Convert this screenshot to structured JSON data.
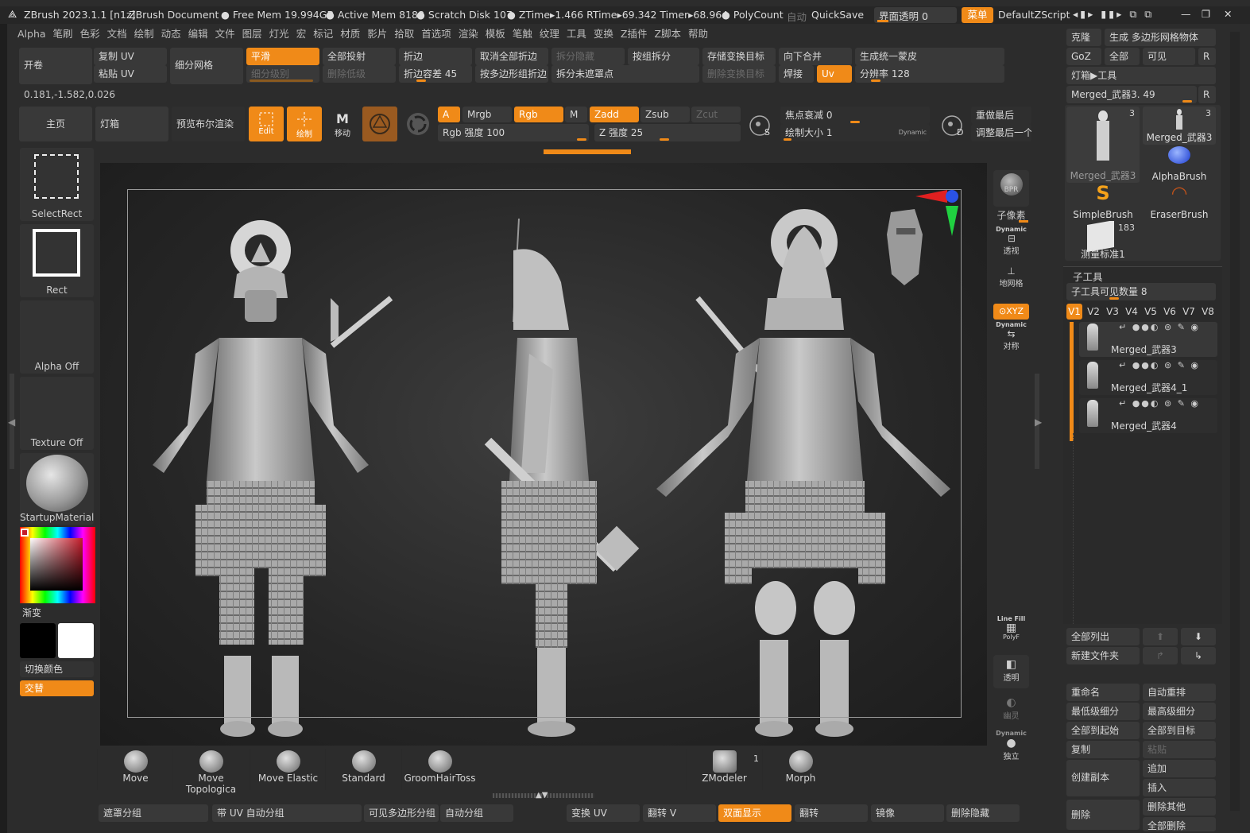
{
  "titlebar": {
    "app": "ZBrush 2023.1.1 [n1z]",
    "doc": "ZBrush Document",
    "free_mem": "Free Mem 19.994GB",
    "active_mem": "Active Mem 8188",
    "scratch": "Scratch Disk 107",
    "ztime": "ZTime▸1.466 RTime▸69.342 Timer▸68.964",
    "polycount": "PolyCount",
    "auto": "自动",
    "quicksave": "QuickSave",
    "transparency": "界面透明 0",
    "menu_btn": "菜单",
    "zscript": "DefaultZScript"
  },
  "menubar": [
    "Alpha",
    "笔刷",
    "色彩",
    "文档",
    "绘制",
    "动态",
    "编辑",
    "文件",
    "图层",
    "灯光",
    "宏",
    "标记",
    "材质",
    "影片",
    "拾取",
    "首选项",
    "渲染",
    "模板",
    "笔触",
    "纹理",
    "工具",
    "变换",
    "Z插件",
    "Z脚本",
    "帮助"
  ],
  "top_shelf": {
    "open": "开卷",
    "copy_uv": "复制 UV",
    "paste_uv": "粘贴 UV",
    "subdivide": "细分网格",
    "smooth": "平滑",
    "subdiv_level": "细分级别",
    "project_all": "全部投射",
    "delete_lower": "删除低级",
    "crease": "折边",
    "crease_tol": "折边容差 45",
    "uncrease_all": "取消全部折边",
    "crease_polygroups": "按多边形组折边",
    "split_hidden": "拆分隐藏",
    "split_unmasked": "拆分未遮罩点",
    "groups_split": "按组拆分",
    "store_morph": "存储变换目标",
    "delete_morph": "删除变换目标",
    "merge_down": "向下合并",
    "weld": "焊接",
    "uv": "Uv",
    "unified_skin": "生成统一蒙皮",
    "resolution": "分辨率 128"
  },
  "coords": "0.181,-1.582,0.026",
  "toolbar": {
    "home": "主页",
    "lightbox": "灯箱",
    "preview_boolean": "预览布尔渲染",
    "edit": "Edit",
    "draw": "绘制",
    "move": "移动",
    "a": "A",
    "mrgb": "Mrgb",
    "rgb": "Rgb",
    "m": "M",
    "zadd": "Zadd",
    "zsub": "Zsub",
    "zcut": "Zcut",
    "rgb_intensity": "Rgb 强度 100",
    "z_intensity": "Z 强度 25",
    "focal": "焦点衰减 0",
    "draw_size": "绘制大小 1",
    "dynamic": "Dynamic",
    "redo_last": "重做最后",
    "adjust_last": "调整最后一个"
  },
  "left_panel": {
    "selectrect": "SelectRect",
    "rect": "Rect",
    "alpha_off": "Alpha Off",
    "texture_off": "Texture Off",
    "material": "StartupMaterial",
    "gradient": "渐变",
    "switch_color": "切换颜色",
    "alternate": "交替"
  },
  "right_shelf": {
    "bpr": "BPR",
    "subpixel": "子像素",
    "dynamic": "Dynamic",
    "persp": "透视",
    "floor": "地网格",
    "xyz": "⊙XYZ",
    "dynamic2": "Dynamic",
    "sym": "对称",
    "linefill": "Line Fill",
    "polyf": "PolyF",
    "transp": "透明",
    "ghost": "幽灵",
    "dynamic3": "Dynamic",
    "solo": "独立"
  },
  "tool_panel": {
    "clone": "克隆",
    "make_polymesh": "生成 多边形网格物体",
    "goz": "GoZ",
    "all": "全部",
    "visible": "可见",
    "r": "R",
    "lightbox_tool": "灯箱▶工具",
    "current_tool": "Merged_武器3. 49",
    "tools": [
      {
        "name": "Merged_武器3",
        "count": "3"
      },
      {
        "name": "Merged_武器3",
        "count": "3"
      },
      {
        "name": "AlphaBrush",
        "count": ""
      },
      {
        "name": "SimpleBrush",
        "count": ""
      },
      {
        "name": "EraserBrush",
        "count": ""
      },
      {
        "name": "测量标准1",
        "count": "183"
      }
    ],
    "subtool_title": "子工具",
    "subtool_visible": "子工具可见数量 8",
    "versions": [
      "V1",
      "V2",
      "V3",
      "V4",
      "V5",
      "V6",
      "V7",
      "V8"
    ],
    "subtools": [
      "Merged_武器3",
      "Merged_武器4_1",
      "Merged_武器4"
    ],
    "list_all": "全部列出",
    "new_folder": "新建文件夹",
    "rename": "重命名",
    "auto_reorder": "自动重排",
    "lowest_subdiv": "最低级细分",
    "highest_subdiv": "最高级细分",
    "all_to_start": "全部到起始",
    "all_to_target": "全部到目标",
    "duplicate": "复制",
    "paste": "粘贴",
    "create_copy": "创建副本",
    "append": "追加",
    "insert": "插入",
    "delete": "删除",
    "delete_other": "删除其他",
    "delete_all": "全部删除"
  },
  "brushes": [
    "Move",
    "Move Topologica",
    "Move Elastic",
    "Standard",
    "GroomHairToss",
    "ZModeler",
    "Morph"
  ],
  "zmodeler_count": "1",
  "bottom_bar": [
    "遮罩分组",
    "带 UV 自动分组",
    "可见多边形分组",
    "自动分组",
    "变换 UV",
    "翻转 V",
    "双面显示",
    "翻转",
    "镜像",
    "删除隐藏"
  ]
}
